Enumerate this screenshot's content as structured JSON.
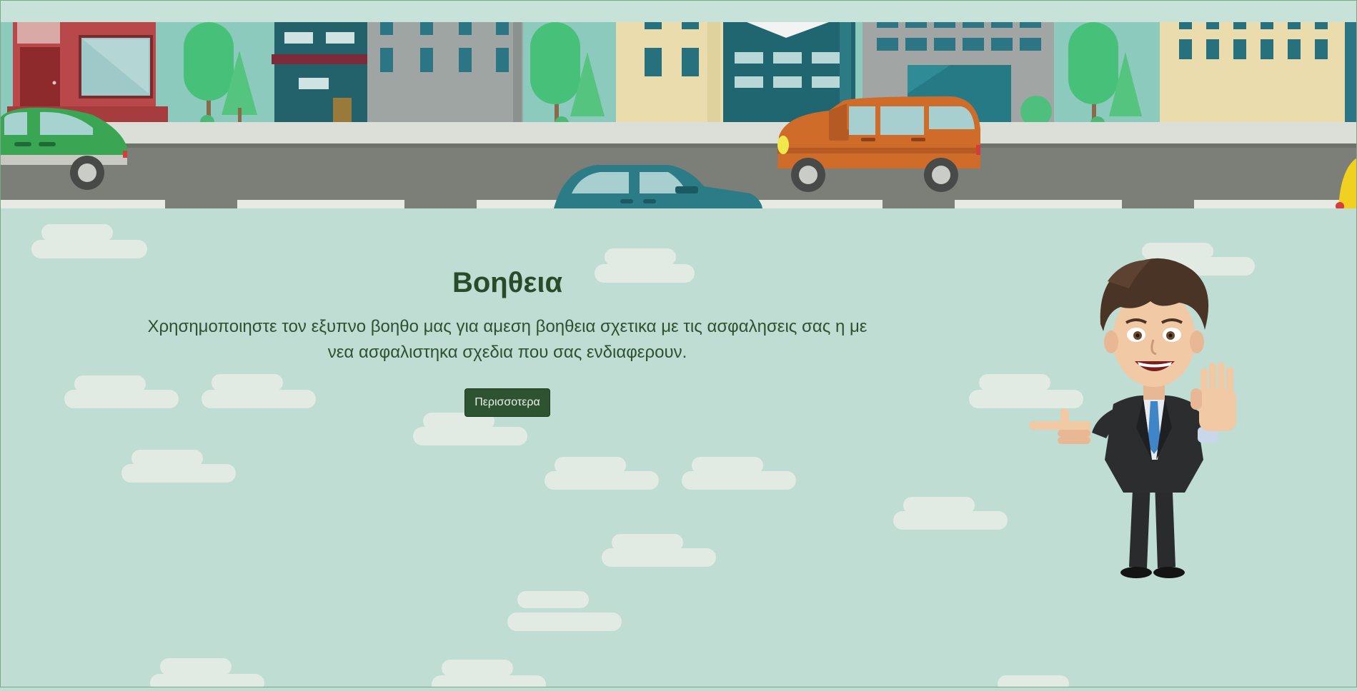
{
  "hero": {
    "title": "Βοηθεια",
    "description": "Χρησημοποιηστε τον εξυπνο βοηθο μας για αμεση βοηθεια σχετικα με τις ασφαλησεις σας η με νεα ασφαλιστηκα σχεδια που σας ενδιαφερουν.",
    "more_button": "Περισσοτερα"
  },
  "colors": {
    "background": "#c0ddd4",
    "title": "#284b2a",
    "button": "#2d5330",
    "road": "#7c7e78",
    "sky": "#8ccabd"
  },
  "icons": {
    "banner": "city-street-illustration",
    "mascot": "businessman-mascot"
  }
}
